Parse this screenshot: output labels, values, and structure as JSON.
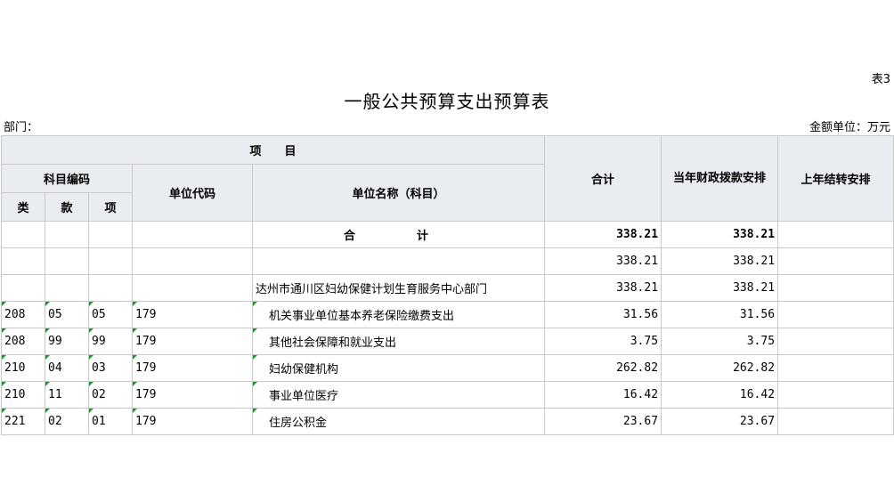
{
  "table_no": "表3",
  "title": "一般公共预算支出预算表",
  "dept_label": "部门：",
  "unit_label": "金额单位：万元",
  "header": {
    "project": "项　　目",
    "subject_code": "科目编码",
    "lei": "类",
    "kuan": "款",
    "xiang": "项",
    "unit_code": "单位代码",
    "unit_name": "单位名称（科目）",
    "total": "合计",
    "current_year": "当年财政拨款安排",
    "carry_over": "上年结转安排"
  },
  "rows": [
    {
      "lei": "",
      "kuan": "",
      "xiang": "",
      "unit_code": "",
      "name": "合　计",
      "total": "338.21",
      "current": "338.21",
      "carry": ""
    },
    {
      "lei": "",
      "kuan": "",
      "xiang": "",
      "unit_code": "",
      "name": "",
      "total": "338.21",
      "current": "338.21",
      "carry": ""
    },
    {
      "lei": "",
      "kuan": "",
      "xiang": "",
      "unit_code": "",
      "name": "达州市通川区妇幼保健计划生育服务中心部门",
      "total": "338.21",
      "current": "338.21",
      "carry": ""
    },
    {
      "lei": "208",
      "kuan": "05",
      "xiang": "05",
      "unit_code": "179",
      "name": "机关事业单位基本养老保险缴费支出",
      "total": "31.56",
      "current": "31.56",
      "carry": ""
    },
    {
      "lei": "208",
      "kuan": "99",
      "xiang": "99",
      "unit_code": "179",
      "name": "其他社会保障和就业支出",
      "total": "3.75",
      "current": "3.75",
      "carry": ""
    },
    {
      "lei": "210",
      "kuan": "04",
      "xiang": "03",
      "unit_code": "179",
      "name": "妇幼保健机构",
      "total": "262.82",
      "current": "262.82",
      "carry": ""
    },
    {
      "lei": "210",
      "kuan": "11",
      "xiang": "02",
      "unit_code": "179",
      "name": "事业单位医疗",
      "total": "16.42",
      "current": "16.42",
      "carry": ""
    },
    {
      "lei": "221",
      "kuan": "02",
      "xiang": "01",
      "unit_code": "179",
      "name": "住房公积金",
      "total": "23.67",
      "current": "23.67",
      "carry": ""
    }
  ]
}
